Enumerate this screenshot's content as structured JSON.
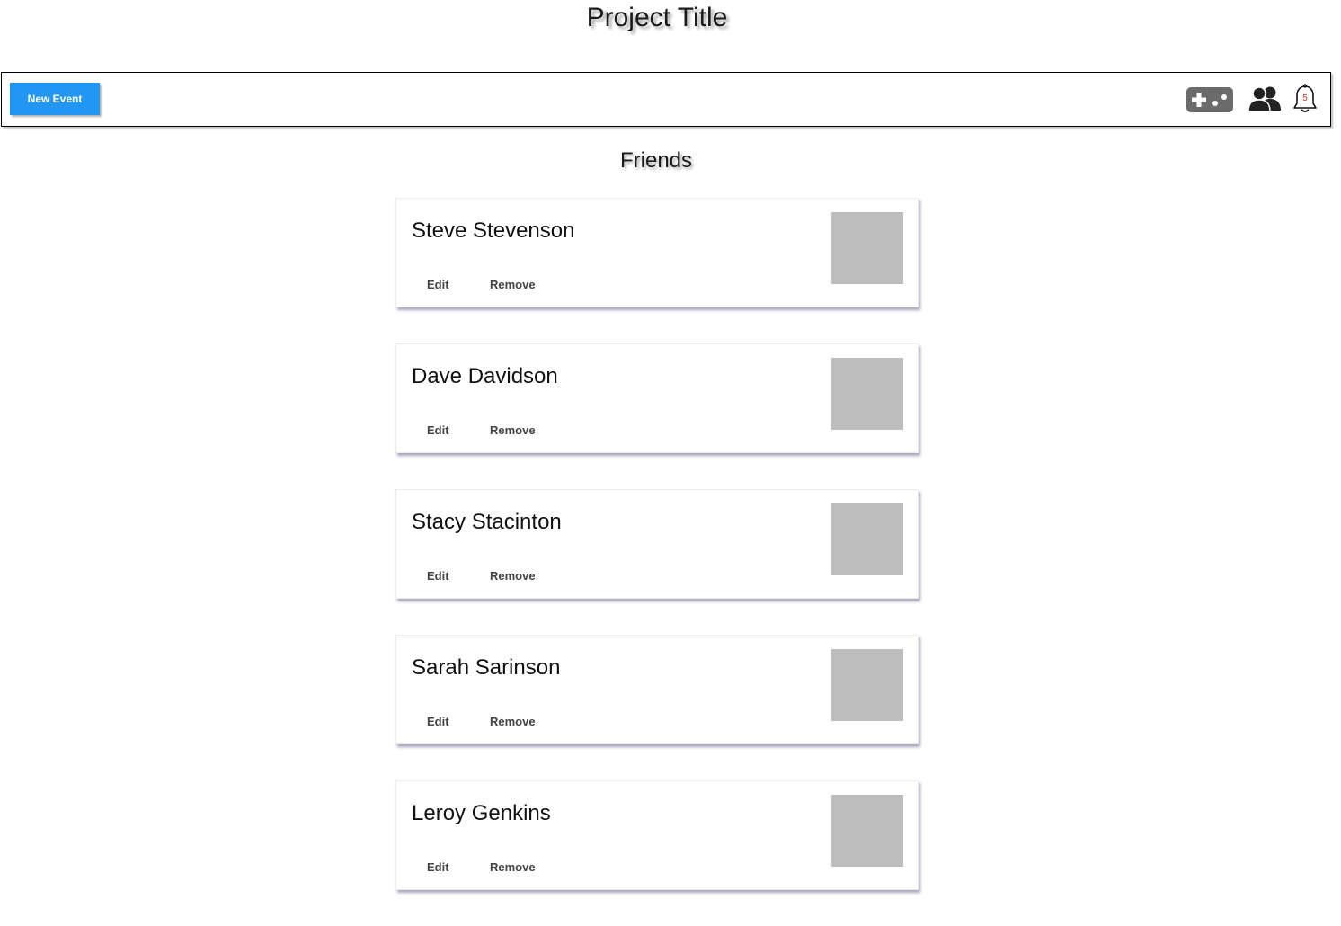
{
  "app": {
    "title": "Project Title"
  },
  "toolbar": {
    "new_event_label": "New Event",
    "icons": [
      "gamepad-icon",
      "friends-icon",
      "bell-icon"
    ],
    "notification_count": "5",
    "accent_color": "#2196f3"
  },
  "main": {
    "section_title": "Friends",
    "friends": [
      {
        "name": "Steve Stevenson",
        "edit_label": "Edit",
        "remove_label": "Remove"
      },
      {
        "name": "Dave Davidson",
        "edit_label": "Edit",
        "remove_label": "Remove"
      },
      {
        "name": "Stacy Stacinton",
        "edit_label": "Edit",
        "remove_label": "Remove"
      },
      {
        "name": "Sarah Sarinson",
        "edit_label": "Edit",
        "remove_label": "Remove"
      },
      {
        "name": "Leroy Genkins",
        "edit_label": "Edit",
        "remove_label": "Remove"
      }
    ]
  }
}
